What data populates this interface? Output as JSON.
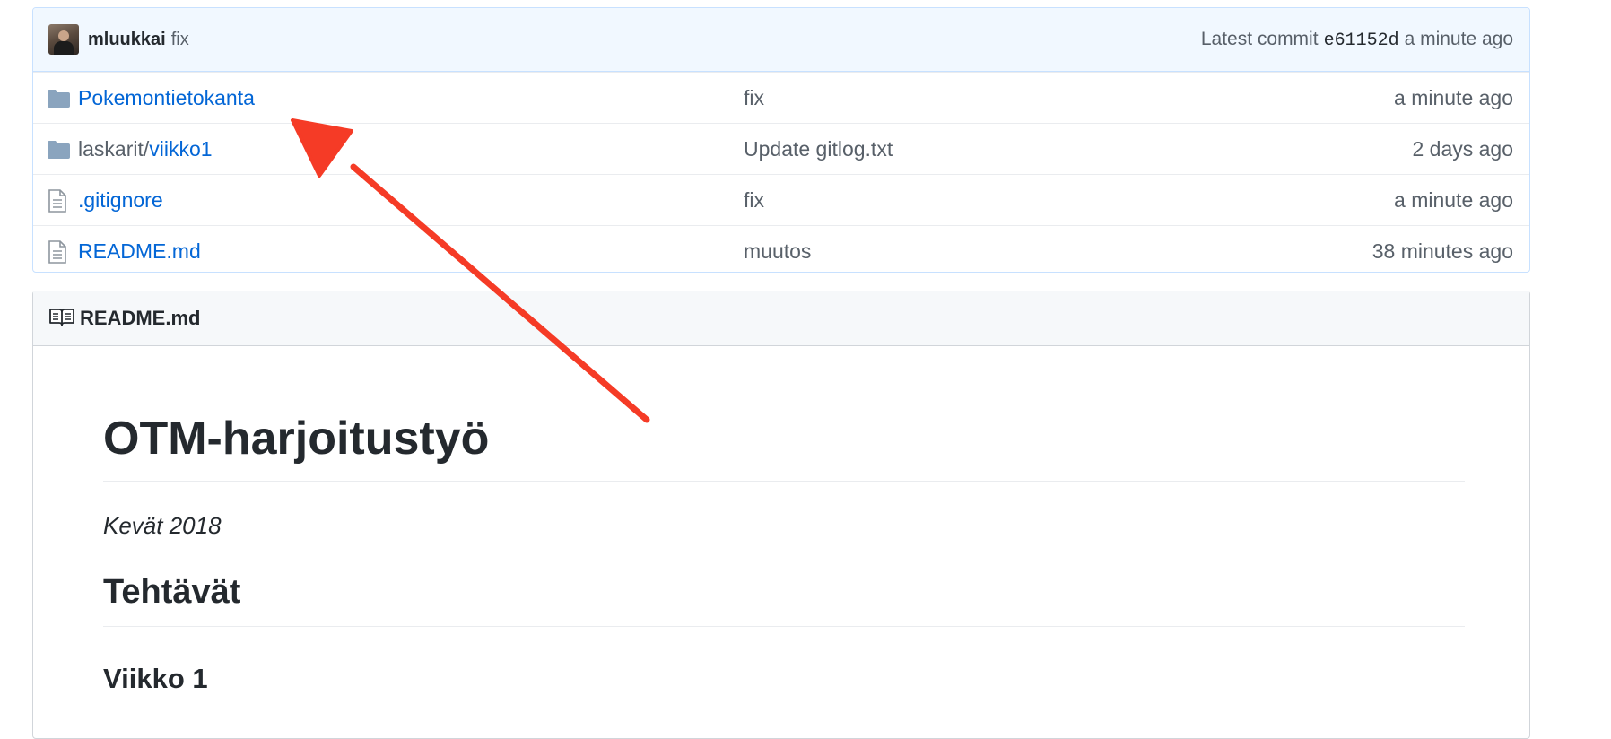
{
  "latest_commit": {
    "author": "mluukkai",
    "message": "fix",
    "prefix": "Latest commit",
    "sha": "e61152d",
    "time": "a minute ago"
  },
  "files": [
    {
      "type": "folder",
      "name_prefix": "",
      "name": "Pokemontietokanta",
      "message": "fix",
      "age": "a minute ago"
    },
    {
      "type": "folder",
      "name_prefix": "laskarit/",
      "name": "viikko1",
      "message": "Update gitlog.txt",
      "age": "2 days ago"
    },
    {
      "type": "file",
      "name_prefix": "",
      "name": ".gitignore",
      "message": "fix",
      "age": "a minute ago"
    },
    {
      "type": "file",
      "name_prefix": "",
      "name": "README.md",
      "message": "muutos",
      "age": "38 minutes ago"
    }
  ],
  "readme": {
    "header_title": "README.md",
    "h1": "OTM-harjoitustyö",
    "subtitle": "Kevät 2018",
    "h2": "Tehtävät",
    "h3": "Viikko 1"
  },
  "colors": {
    "link": "#0366d6",
    "muted": "#586069",
    "annotation_arrow": "#f53b26"
  },
  "icons": {
    "folder": "folder-icon",
    "file": "file-icon",
    "readme": "book-icon"
  }
}
